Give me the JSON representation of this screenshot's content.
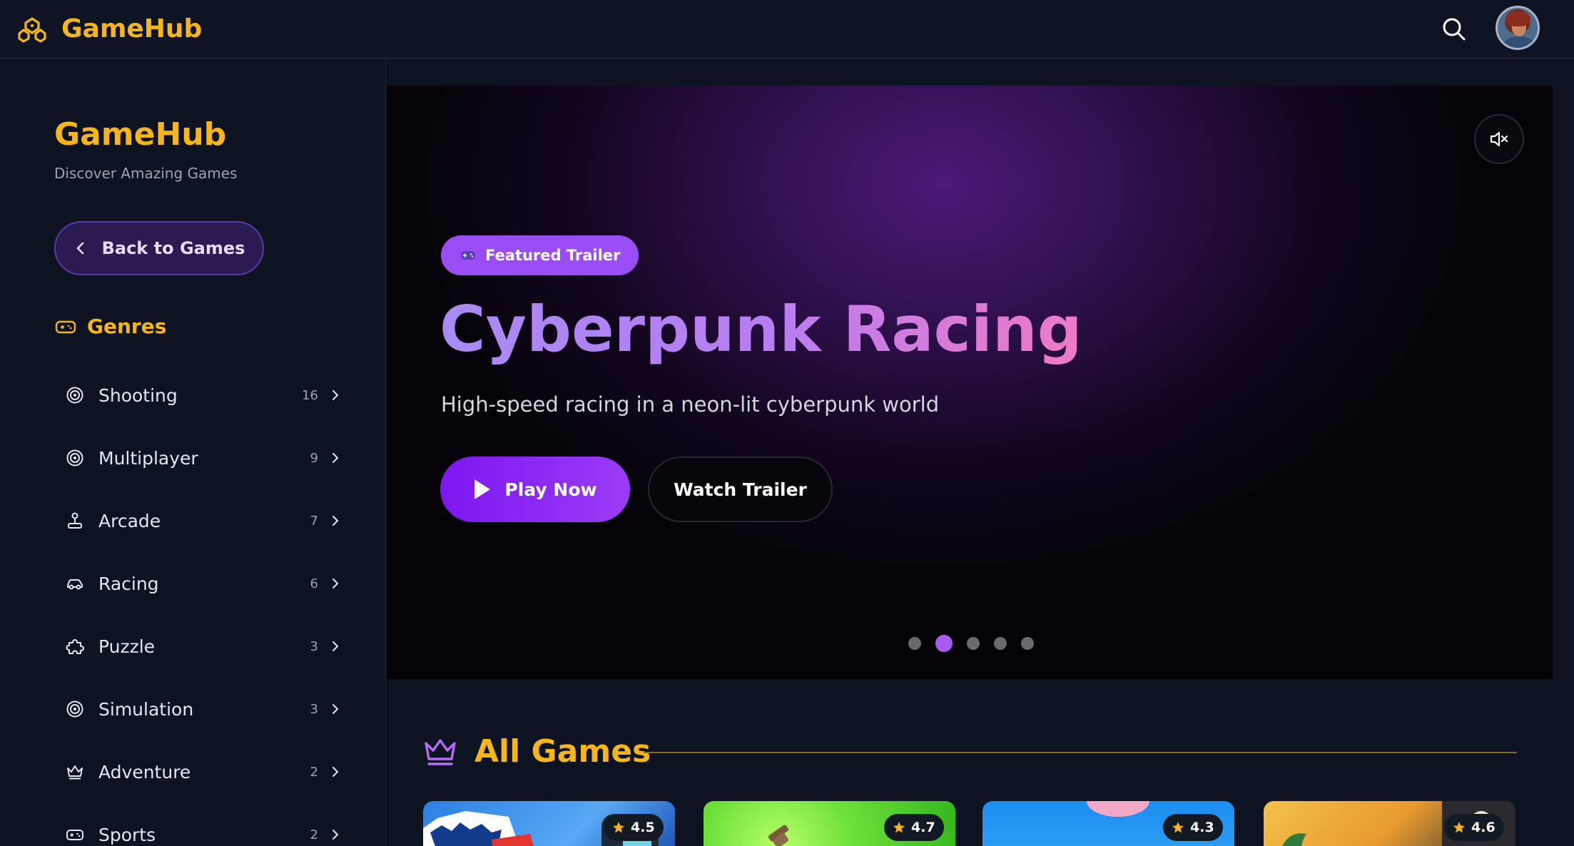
{
  "topbar": {
    "brand": "GameHub",
    "icons": [
      "gamehub-logo-icon",
      "search-icon",
      "user-avatar"
    ]
  },
  "sidebar": {
    "title": "GameHub",
    "subtitle": "Discover Amazing Games",
    "back_label": "Back to Games",
    "genres_label": "Genres",
    "genres": [
      {
        "label": "Shooting",
        "count": "16",
        "icon": "target-icon"
      },
      {
        "label": "Multiplayer",
        "count": "9",
        "icon": "target-icon"
      },
      {
        "label": "Arcade",
        "count": "7",
        "icon": "joystick-icon"
      },
      {
        "label": "Racing",
        "count": "6",
        "icon": "car-icon"
      },
      {
        "label": "Puzzle",
        "count": "3",
        "icon": "puzzle-icon"
      },
      {
        "label": "Simulation",
        "count": "3",
        "icon": "target-icon"
      },
      {
        "label": "Adventure",
        "count": "2",
        "icon": "crown-icon"
      },
      {
        "label": "Sports",
        "count": "2",
        "icon": "gamepad-icon"
      }
    ]
  },
  "hero": {
    "badge": "Featured Trailer",
    "title": "Cyberpunk Racing",
    "description": "High-speed racing in a neon-lit cyberpunk world",
    "play_label": "Play Now",
    "trailer_label": "Watch Trailer",
    "slides_total": 5,
    "active_slide": 2,
    "mute_icon": "volume-muted-icon"
  },
  "all_games": {
    "title": "All Games",
    "cards": [
      {
        "rating": "4.5"
      },
      {
        "rating": "4.7"
      },
      {
        "rating": "4.3"
      },
      {
        "rating": "4.6"
      }
    ]
  },
  "colors": {
    "accent_gold": "#f5b61c",
    "accent_purple": "#9b4df5",
    "background": "#0d1321"
  }
}
